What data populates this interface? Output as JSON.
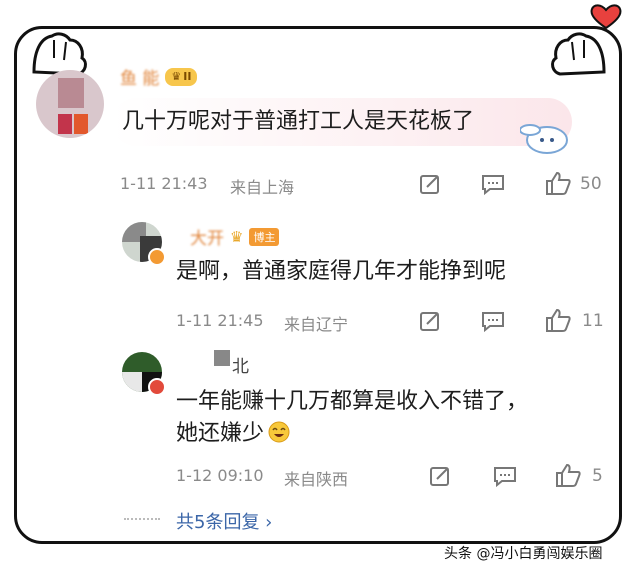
{
  "colors": {
    "frame": "#111111",
    "name": "#e1873f",
    "meta": "#8a8a8a",
    "link": "#3b66a8",
    "badge": "#f39a33"
  },
  "comment_main": {
    "username": "鱼 能",
    "badge_level": "II",
    "text": "几十万呢对于普通打工人是天花板了",
    "time": "1-11 21:43",
    "location": "来自上海",
    "like_count": "50"
  },
  "reply1": {
    "username": "大开",
    "badge_text": "博主",
    "text": "是啊，普通家庭得几年才能挣到呢",
    "time": "1-11 21:45",
    "location": "来自辽宁",
    "like_count": "11"
  },
  "reply2": {
    "username": "北",
    "text_line1": "一年能赚十几万都算是收入不错了，",
    "text_line2": "她还嫌少",
    "time": "1-12 09:10",
    "location": "来自陕西",
    "like_count": "5"
  },
  "more_replies": "共5条回复 ›",
  "watermark": "头条 @冯小白勇闯娱乐圈",
  "icons": [
    "paw-left-icon",
    "paw-right-icon",
    "heart-icon",
    "share-icon",
    "comment-icon",
    "like-icon",
    "laugh-emoji-icon",
    "verified-badge-icon"
  ]
}
